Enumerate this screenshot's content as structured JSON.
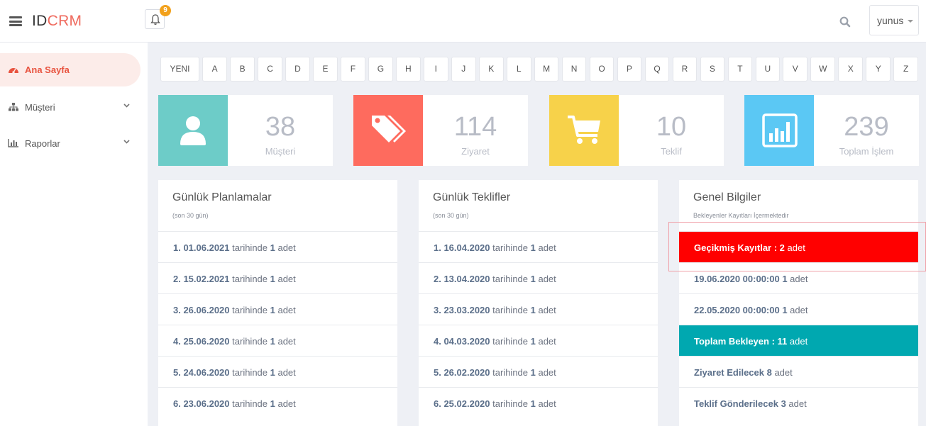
{
  "header": {
    "brand_id": "ID",
    "brand_crm": "CRM",
    "notification_count": "9",
    "user_name": "yunus"
  },
  "sidebar": {
    "items": [
      {
        "label": "Ana Sayfa",
        "icon": "dashboard-icon",
        "active": true
      },
      {
        "label": "Müşteri",
        "icon": "sitemap-icon",
        "active": false
      },
      {
        "label": "Raporlar",
        "icon": "bar-chart-icon",
        "active": false
      }
    ]
  },
  "alphabet": [
    "YENI",
    "A",
    "B",
    "C",
    "D",
    "E",
    "F",
    "G",
    "H",
    "I",
    "J",
    "K",
    "L",
    "M",
    "N",
    "O",
    "P",
    "Q",
    "R",
    "S",
    "T",
    "U",
    "V",
    "W",
    "X",
    "Y",
    "Z"
  ],
  "stats": [
    {
      "value": "38",
      "label": "Müşteri",
      "color": "#6dccc8",
      "icon": "user-icon"
    },
    {
      "value": "114",
      "label": "Ziyaret",
      "color": "#fe6b5e",
      "icon": "tags-icon"
    },
    {
      "value": "10",
      "label": "Teklif",
      "color": "#f7d24a",
      "icon": "cart-icon"
    },
    {
      "value": "239",
      "label": "Toplam İşlem",
      "color": "#5bc8f4",
      "icon": "chart-icon"
    }
  ],
  "panels": {
    "planlamalar": {
      "title": "Günlük Planlamalar",
      "subtitle": "(son 30 gün)",
      "rows": [
        {
          "bold": "1. 01.06.2021",
          "text": " tarihinde ",
          "count": "1",
          "unit": " adet"
        },
        {
          "bold": "2. 15.02.2021",
          "text": " tarihinde ",
          "count": "1",
          "unit": " adet"
        },
        {
          "bold": "3. 26.06.2020",
          "text": " tarihinde ",
          "count": "1",
          "unit": " adet"
        },
        {
          "bold": "4. 25.06.2020",
          "text": " tarihinde ",
          "count": "1",
          "unit": " adet"
        },
        {
          "bold": "5. 24.06.2020",
          "text": " tarihinde ",
          "count": "1",
          "unit": " adet"
        },
        {
          "bold": "6. 23.06.2020",
          "text": " tarihinde ",
          "count": "1",
          "unit": " adet"
        }
      ]
    },
    "teklifler": {
      "title": "Günlük Teklifler",
      "subtitle": "(son 30 gün)",
      "rows": [
        {
          "bold": "1. 16.04.2020",
          "text": " tarihinde ",
          "count": "1",
          "unit": " adet"
        },
        {
          "bold": "2. 13.04.2020",
          "text": " tarihinde ",
          "count": "1",
          "unit": " adet"
        },
        {
          "bold": "3. 23.03.2020",
          "text": " tarihinde ",
          "count": "1",
          "unit": " adet"
        },
        {
          "bold": "4. 04.03.2020",
          "text": " tarihinde ",
          "count": "1",
          "unit": " adet"
        },
        {
          "bold": "5. 26.02.2020",
          "text": " tarihinde ",
          "count": "1",
          "unit": " adet"
        },
        {
          "bold": "6. 25.02.2020",
          "text": " tarihinde ",
          "count": "1",
          "unit": " adet"
        }
      ]
    },
    "genel": {
      "title": "Genel Bilgiler",
      "subtitle": "Bekleyenler Kayıtları İçermektedir",
      "rows": [
        {
          "bold": "Geçikmiş Kayıtlar : 2",
          "unit": " adet"
        },
        {
          "bold": "19.06.2020 00:00:00 1",
          "unit": " adet"
        },
        {
          "bold": "22.05.2020 00:00:00 1",
          "unit": " adet"
        },
        {
          "bold": "Toplam Bekleyen : 11",
          "unit": " adet"
        },
        {
          "bold": "Ziyaret Edilecek 8",
          "unit": " adet"
        },
        {
          "bold": "Teklif Gönderilecek 3",
          "unit": " adet"
        }
      ]
    }
  }
}
